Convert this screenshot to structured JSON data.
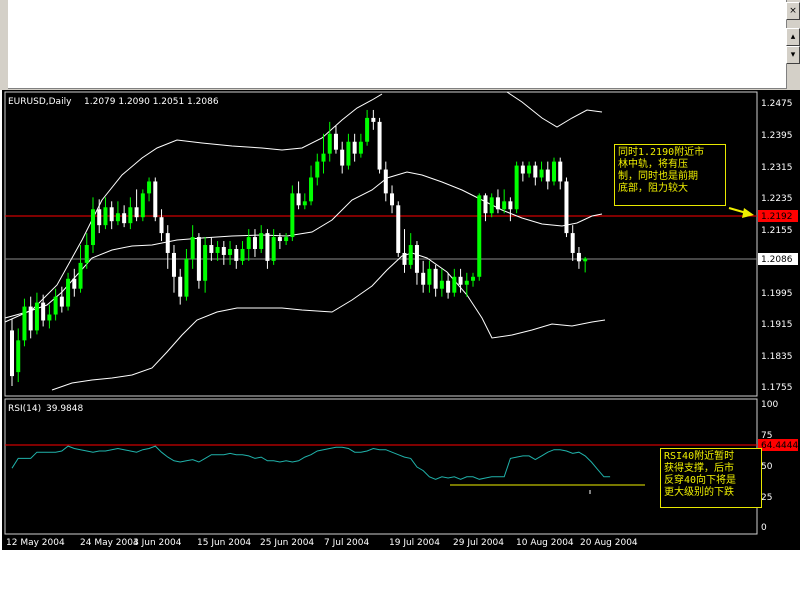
{
  "main_chart": {
    "title": "EURUSD,Daily",
    "ohlc_text": "1.2079 1.2090 1.2051 1.2086",
    "price_ticks": [
      "1.2475",
      "1.2395",
      "1.2315",
      "1.2235",
      "1.2155",
      "1.2075",
      "1.1995",
      "1.1915",
      "1.1835",
      "1.1755"
    ],
    "level_price": "1.2192",
    "current_price": "1.2086",
    "note": "同时1.2190附近市\n林中轨，将有压\n制，同时也是前期\n底部，阻力较大"
  },
  "rsi_panel": {
    "title": "RSI(14)",
    "value_text": "39.9848",
    "ticks": [
      "100",
      "75",
      "50",
      "25",
      "0"
    ],
    "level_label": "64.4444",
    "note": "RSI40附近暂时\n获得支撑，后市\n反穿40向下将是\n更大级别的下跌"
  },
  "date_labels": [
    "12 May 2004",
    "24 May 2004",
    "3 Jun 2004",
    "15 Jun 2004",
    "25 Jun 2004",
    "7 Jul 2004",
    "19 Jul 2004",
    "29 Jul 2004",
    "10 Aug 2004",
    "20 Aug 2004"
  ],
  "colors": {
    "bull": "#00ff00",
    "bear": "#ffffff",
    "bands": "#ffffff",
    "level": "#ff0000",
    "rsi": "#20b2aa",
    "note": "#f0f000"
  },
  "chart_data": {
    "type": "candlestick",
    "symbol": "EURUSD",
    "timeframe": "Daily",
    "ylim": [
      1.173,
      1.249
    ],
    "horizontal_lines": [
      1.2192,
      1.2086
    ],
    "candles": [
      [
        1.1905,
        1.179,
        1.1935,
        1.1765
      ],
      [
        1.18,
        1.188,
        1.191,
        1.1775
      ],
      [
        1.188,
        1.1965,
        1.1985,
        1.1865
      ],
      [
        1.1965,
        1.1905,
        1.199,
        1.1885
      ],
      [
        1.1905,
        1.1975,
        1.2,
        1.1895
      ],
      [
        1.1975,
        1.193,
        1.1995,
        1.1915
      ],
      [
        1.193,
        1.1945,
        1.197,
        1.191
      ],
      [
        1.1945,
        1.199,
        1.201,
        1.193
      ],
      [
        1.199,
        1.1965,
        1.2015,
        1.195
      ],
      [
        1.1965,
        1.2035,
        1.205,
        1.1955
      ],
      [
        1.2035,
        1.201,
        1.206,
        1.199
      ],
      [
        1.201,
        1.2075,
        1.212,
        1.2
      ],
      [
        1.2075,
        1.212,
        1.215,
        1.206
      ],
      [
        1.212,
        1.221,
        1.224,
        1.21
      ],
      [
        1.221,
        1.217,
        1.2235,
        1.215
      ],
      [
        1.217,
        1.2215,
        1.224,
        1.216
      ],
      [
        1.2215,
        1.218,
        1.223,
        1.216
      ],
      [
        1.218,
        1.22,
        1.223,
        1.217
      ],
      [
        1.22,
        1.2175,
        1.222,
        1.2165
      ],
      [
        1.2175,
        1.2215,
        1.224,
        1.216
      ],
      [
        1.2215,
        1.219,
        1.226,
        1.218
      ],
      [
        1.219,
        1.225,
        1.226,
        1.218
      ],
      [
        1.225,
        1.228,
        1.229,
        1.223
      ],
      [
        1.228,
        1.219,
        1.229,
        1.218
      ],
      [
        1.219,
        1.215,
        1.221,
        1.213
      ],
      [
        1.215,
        1.21,
        1.217,
        1.206
      ],
      [
        1.21,
        1.204,
        1.212,
        1.2
      ],
      [
        1.204,
        1.199,
        1.206,
        1.197
      ],
      [
        1.199,
        1.2085,
        1.211,
        1.198
      ],
      [
        1.2085,
        1.214,
        1.217,
        1.206
      ],
      [
        1.214,
        1.203,
        1.215,
        1.201
      ],
      [
        1.203,
        1.212,
        1.214,
        1.2
      ],
      [
        1.212,
        1.21,
        1.214,
        1.208
      ],
      [
        1.21,
        1.2115,
        1.213,
        1.208
      ],
      [
        1.2115,
        1.2095,
        1.213,
        1.207
      ],
      [
        1.2095,
        1.211,
        1.213,
        1.207
      ],
      [
        1.211,
        1.208,
        1.212,
        1.206
      ],
      [
        1.208,
        1.211,
        1.213,
        1.207
      ],
      [
        1.211,
        1.214,
        1.216,
        1.208
      ],
      [
        1.214,
        1.211,
        1.216,
        1.209
      ],
      [
        1.211,
        1.215,
        1.217,
        1.21
      ],
      [
        1.215,
        1.208,
        1.216,
        1.206
      ],
      [
        1.208,
        1.214,
        1.216,
        1.207
      ],
      [
        1.214,
        1.213,
        1.215,
        1.211
      ],
      [
        1.213,
        1.214,
        1.215,
        1.212
      ],
      [
        1.214,
        1.225,
        1.227,
        1.213
      ],
      [
        1.225,
        1.222,
        1.228,
        1.221
      ],
      [
        1.222,
        1.223,
        1.225,
        1.221
      ],
      [
        1.223,
        1.229,
        1.232,
        1.222
      ],
      [
        1.229,
        1.233,
        1.235,
        1.227
      ],
      [
        1.233,
        1.235,
        1.24,
        1.23
      ],
      [
        1.235,
        1.24,
        1.243,
        1.233
      ],
      [
        1.24,
        1.236,
        1.242,
        1.235
      ],
      [
        1.236,
        1.232,
        1.238,
        1.23
      ],
      [
        1.232,
        1.238,
        1.24,
        1.231
      ],
      [
        1.238,
        1.235,
        1.24,
        1.233
      ],
      [
        1.235,
        1.238,
        1.24,
        1.234
      ],
      [
        1.238,
        1.244,
        1.246,
        1.237
      ],
      [
        1.244,
        1.243,
        1.246,
        1.241
      ],
      [
        1.243,
        1.231,
        1.244,
        1.23
      ],
      [
        1.231,
        1.225,
        1.233,
        1.223
      ],
      [
        1.225,
        1.222,
        1.227,
        1.22
      ],
      [
        1.222,
        1.21,
        1.223,
        1.209
      ],
      [
        1.21,
        1.207,
        1.216,
        1.205
      ],
      [
        1.207,
        1.212,
        1.215,
        1.206
      ],
      [
        1.212,
        1.205,
        1.213,
        1.202
      ],
      [
        1.205,
        1.202,
        1.208,
        1.2
      ],
      [
        1.202,
        1.206,
        1.208,
        1.2
      ],
      [
        1.206,
        1.201,
        1.207,
        1.199
      ],
      [
        1.201,
        1.203,
        1.206,
        1.199
      ],
      [
        1.203,
        1.2,
        1.205,
        1.1985
      ],
      [
        1.2,
        1.204,
        1.206,
        1.199
      ],
      [
        1.204,
        1.202,
        1.206,
        1.2
      ],
      [
        1.202,
        1.203,
        1.205,
        1.199
      ],
      [
        1.203,
        1.204,
        1.205,
        1.2015
      ],
      [
        1.204,
        1.2245,
        1.225,
        1.203
      ],
      [
        1.2245,
        1.22,
        1.225,
        1.218
      ],
      [
        1.22,
        1.224,
        1.225,
        1.219
      ],
      [
        1.224,
        1.221,
        1.226,
        1.22
      ],
      [
        1.221,
        1.223,
        1.226,
        1.22
      ],
      [
        1.223,
        1.221,
        1.224,
        1.218
      ],
      [
        1.221,
        1.232,
        1.233,
        1.22
      ],
      [
        1.232,
        1.23,
        1.233,
        1.228
      ],
      [
        1.23,
        1.232,
        1.233,
        1.229
      ],
      [
        1.232,
        1.229,
        1.233,
        1.227
      ],
      [
        1.229,
        1.231,
        1.233,
        1.228
      ],
      [
        1.231,
        1.228,
        1.233,
        1.226
      ],
      [
        1.228,
        1.233,
        1.234,
        1.227
      ],
      [
        1.233,
        1.228,
        1.234,
        1.226
      ],
      [
        1.228,
        1.215,
        1.229,
        1.214
      ],
      [
        1.215,
        1.21,
        1.217,
        1.208
      ],
      [
        1.21,
        1.2079,
        1.2115,
        1.206
      ],
      [
        1.2079,
        1.2086,
        1.209,
        1.2051
      ]
    ],
    "rsi": [
      47,
      55,
      55,
      55,
      60,
      60,
      60,
      60,
      61,
      65,
      63,
      62,
      61,
      60,
      61,
      61,
      62,
      63,
      62,
      61,
      60,
      62,
      63,
      65,
      60,
      56,
      53,
      52,
      53,
      54,
      52,
      55,
      58,
      58,
      58,
      59,
      58,
      58,
      57,
      55,
      56,
      53,
      53,
      52,
      53,
      52,
      53,
      56,
      58,
      61,
      62,
      63,
      64,
      64,
      63,
      60,
      60,
      61,
      63,
      62,
      62,
      60,
      58,
      56,
      55,
      48,
      45,
      40,
      38,
      40,
      39,
      40,
      38,
      40,
      40,
      38,
      39,
      40,
      40,
      40,
      55,
      56,
      57,
      57,
      54,
      57,
      60,
      62,
      62,
      61,
      59,
      60,
      57,
      52,
      46,
      40,
      40
    ]
  }
}
